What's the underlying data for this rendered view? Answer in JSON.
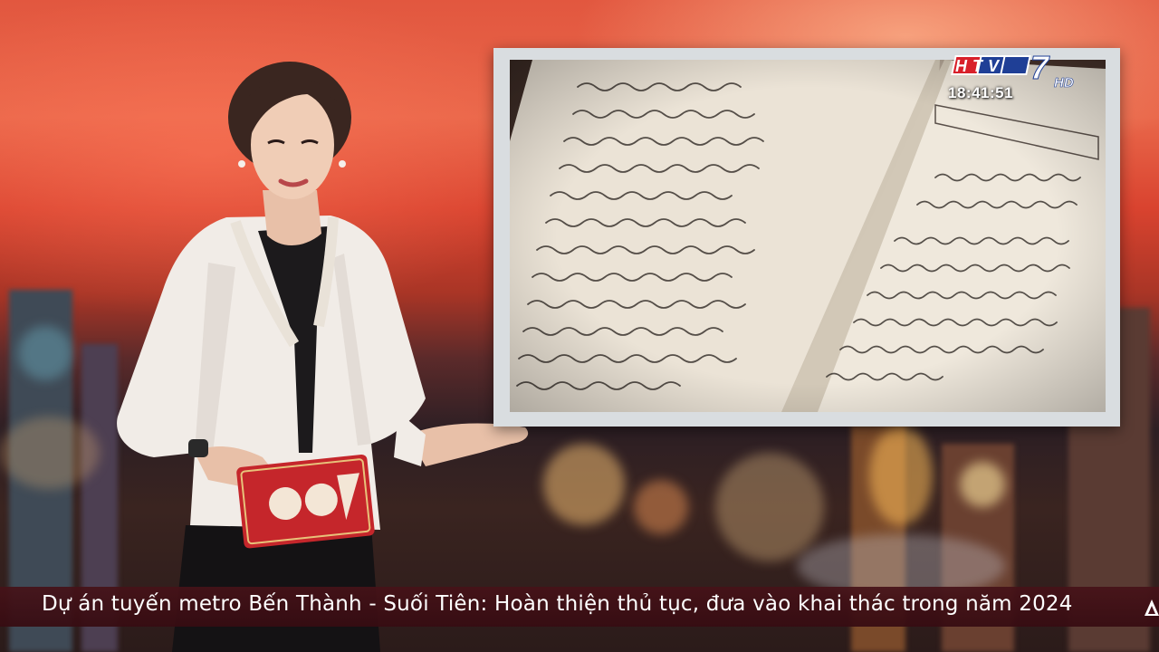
{
  "broadcast": {
    "channel_logo": {
      "text": "HTV7",
      "suffix": "HD",
      "colors": {
        "red": "#d8202a",
        "blue": "#1f3f96",
        "white": "#ffffff"
      }
    },
    "clock": "18:41:51"
  },
  "ticker": {
    "headline": "Dự án tuyến metro Bến Thành - Suối Tiên: Hoàn thiện thủ tục, đưa vào khai thác trong năm 2024"
  },
  "props": {
    "anchor_card_icon": "htv-card-logo-icon",
    "notebook_icon": "handwritten-notebook-image"
  },
  "colors": {
    "sky_red": "#e2573f",
    "ticker_bg": "#46121a",
    "panel_frame": "#d9dde0",
    "paper": "#ece5d8",
    "ink": "#3b3530"
  }
}
